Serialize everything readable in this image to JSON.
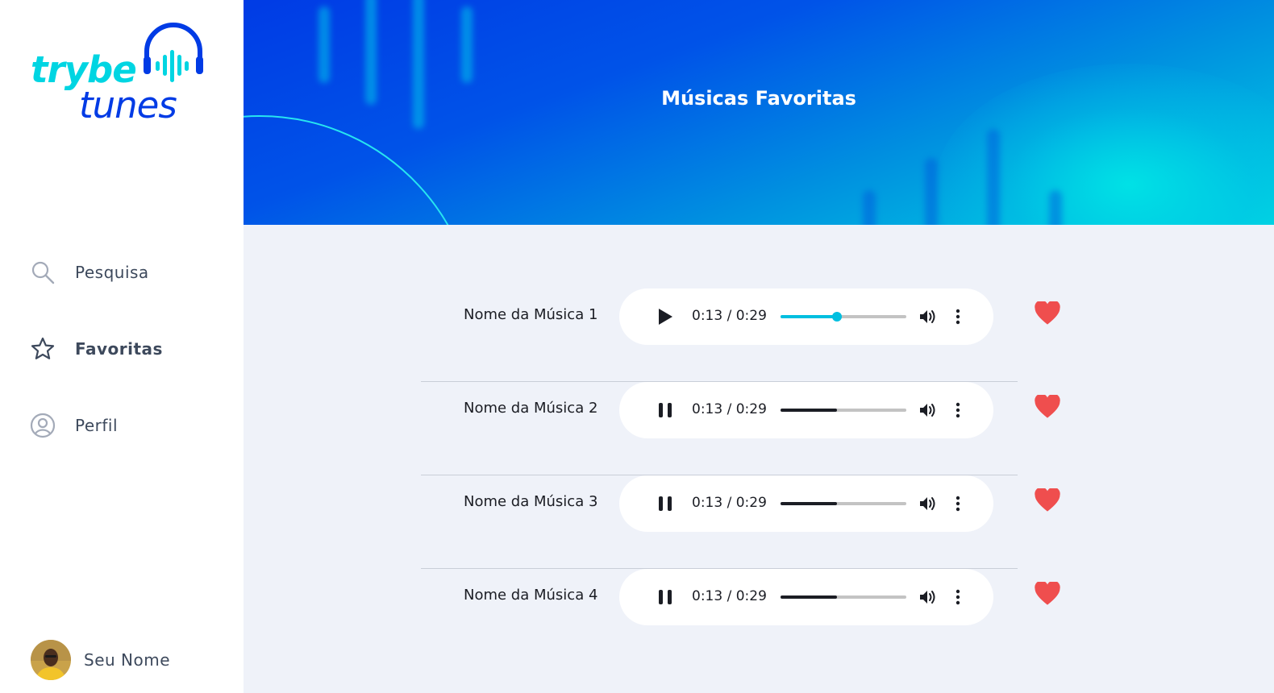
{
  "brand": {
    "word1": "trybe",
    "word2": "tunes",
    "accent": "#00d5e2",
    "primary": "#003be5"
  },
  "sidebar": {
    "items": [
      {
        "label": "Pesquisa",
        "icon": "search-icon",
        "active": false
      },
      {
        "label": "Favoritas",
        "icon": "star-icon",
        "active": true
      },
      {
        "label": "Perfil",
        "icon": "user-circle-icon",
        "active": false
      }
    ],
    "user": {
      "name": "Seu Nome"
    }
  },
  "header": {
    "title": "Músicas Favoritas"
  },
  "songs": [
    {
      "name": "Nome da Música 1",
      "state": "paused",
      "time": "0:13 / 0:29",
      "progress": 0.45,
      "favorite": true
    },
    {
      "name": "Nome da Música 2",
      "state": "playing",
      "time": "0:13 / 0:29",
      "progress": 0.45,
      "favorite": true
    },
    {
      "name": "Nome da Música 3",
      "state": "playing",
      "time": "0:13 / 0:29",
      "progress": 0.45,
      "favorite": true
    },
    {
      "name": "Nome da Música 4",
      "state": "playing",
      "time": "0:13 / 0:29",
      "progress": 0.45,
      "favorite": true
    }
  ],
  "colors": {
    "heart": "#ef4e4e",
    "progress_active": "#00bfe0",
    "progress_default": "#1b1d24"
  }
}
